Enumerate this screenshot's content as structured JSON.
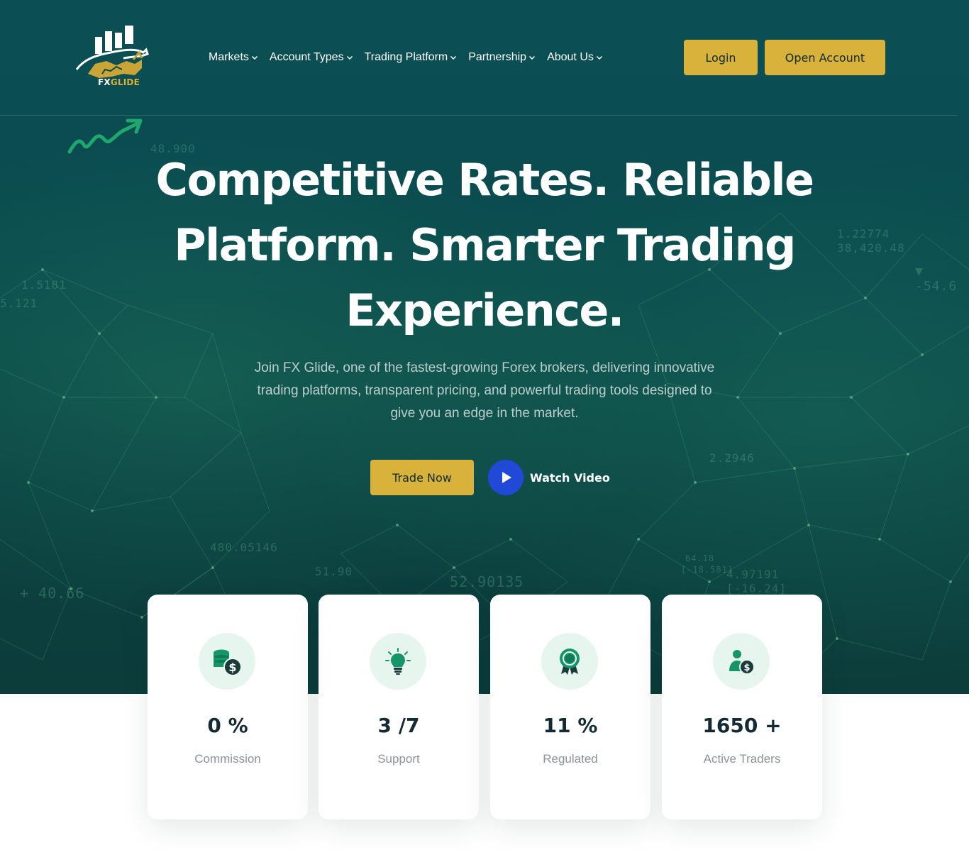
{
  "brand": {
    "logo_text_fx": "FX",
    "logo_text_rest": "GLIDE",
    "logo_icon": "bull-chart-logo",
    "gold": "#d9b23b",
    "dark_teal": "#0a4a4e",
    "play_blue": "#1f49d6"
  },
  "nav": {
    "items": [
      {
        "label": "Markets"
      },
      {
        "label": "Account Types"
      },
      {
        "label": "Trading Platform"
      },
      {
        "label": "Partnership"
      },
      {
        "label": "About Us"
      }
    ]
  },
  "header": {
    "login_label": "Login",
    "open_account_label": "Open Account"
  },
  "hero": {
    "headline_line1": "Competitive Rates. Reliable",
    "headline_line2": "Platform. Smarter Trading",
    "headline_line3": "Experience.",
    "subtext": "Join FX Glide, one of the fastest-growing Forex brokers, delivering innovative trading platforms, transparent pricing, and powerful trading tools designed to give you an edge in the market.",
    "trade_now_label": "Trade Now",
    "watch_video_label": "Watch Video",
    "tickers": [
      "48.900",
      "1.22774",
      "38,420.48",
      "▼ -54.6",
      "5.121",
      "+ 40.66",
      "480.05146",
      "51.90",
      "52.90135",
      "64.18",
      "[-18.581]",
      "4.97191",
      "[-16.24]",
      "2.2946",
      "1.5181"
    ]
  },
  "stats": [
    {
      "icon": "coins-dollar-icon",
      "value": "0 %",
      "label": "Commission"
    },
    {
      "icon": "lightbulb-icon",
      "value": "3 /7",
      "label": "Support"
    },
    {
      "icon": "award-ribbon-icon",
      "value": "11 %",
      "label": "Regulated"
    },
    {
      "icon": "user-dollar-icon",
      "value": "1650 +",
      "label": "Active Traders"
    }
  ]
}
